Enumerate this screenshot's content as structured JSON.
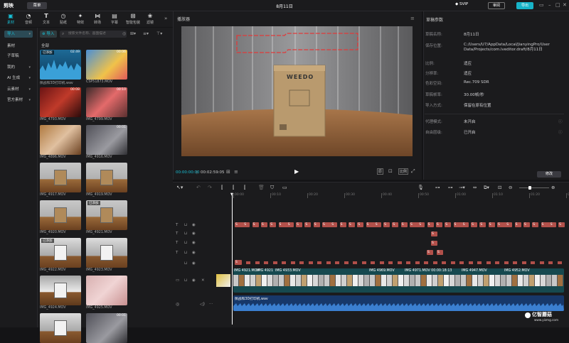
{
  "app": {
    "logo": "剪映",
    "menu": "菜单",
    "title": "8月11日",
    "vip": "SVIP",
    "share": "审阅",
    "export": "导出"
  },
  "toolbar": [
    {
      "label": "素材",
      "icon": "media-icon",
      "active": true
    },
    {
      "label": "音频",
      "icon": "audio-icon"
    },
    {
      "label": "文本",
      "icon": "text-icon"
    },
    {
      "label": "贴纸",
      "icon": "sticker-icon"
    },
    {
      "label": "特效",
      "icon": "effects-icon"
    },
    {
      "label": "转场",
      "icon": "transition-icon"
    },
    {
      "label": "字幕",
      "icon": "captions-icon"
    },
    {
      "label": "智能包装",
      "icon": "smart-pack-icon"
    },
    {
      "label": "滤镜",
      "icon": "filter-icon"
    }
  ],
  "leftnav": [
    {
      "label": "导入",
      "selected": true
    },
    {
      "label": "素材"
    },
    {
      "label": "子草稿"
    },
    {
      "label": "我的"
    },
    {
      "label": "AI 生成"
    },
    {
      "label": "云素材"
    },
    {
      "label": "官方素材"
    }
  ],
  "media": {
    "import": "导入",
    "search_placeholder": "搜索文件名称、画面描述",
    "section": "全部",
    "items": [
      {
        "name": "佩战和3D打印机.wav",
        "dur": "02:49",
        "type": "audio",
        "added": "已添加"
      },
      {
        "name": "CSP51873.MOV",
        "dur": "00:06",
        "type": "art"
      },
      {
        "name": "IMG_4793.MOV",
        "dur": "00:08",
        "type": "red"
      },
      {
        "name": "IMG_4799.MOV",
        "dur": "00:10",
        "type": "phone"
      },
      {
        "name": "IMG_4896.MOV",
        "dur": "",
        "type": "hand"
      },
      {
        "name": "IMG_4916.MOV",
        "dur": "00:01",
        "type": "dark"
      },
      {
        "name": "IMG_4917.MOV",
        "dur": "",
        "type": "box"
      },
      {
        "name": "IMG_4919.MOV",
        "dur": "",
        "type": "box"
      },
      {
        "name": "IMG_4920.MOV",
        "dur": "",
        "type": "box"
      },
      {
        "name": "IMG_4921.MOV",
        "dur": "",
        "type": "box",
        "added": "已添加"
      },
      {
        "name": "IMG_4922.MOV",
        "dur": "",
        "type": "printer",
        "added": "已添加"
      },
      {
        "name": "IMG_4923.MOV",
        "dur": "",
        "type": "printer"
      },
      {
        "name": "IMG_4924.MOV",
        "dur": "",
        "type": "printer2"
      },
      {
        "name": "IMG_4925.MOV",
        "dur": "",
        "type": "pink"
      },
      {
        "name": "",
        "dur": "",
        "type": "printer"
      },
      {
        "name": "",
        "dur": "00:01",
        "type": "dark"
      }
    ]
  },
  "player": {
    "title": "播放器",
    "current": "00:00:00:00",
    "total": "00:02:59:05",
    "box_brand": "WEEDO"
  },
  "props": {
    "title": "草稿参数",
    "rows": [
      {
        "label": "草稿名称:",
        "value": "8月11日"
      },
      {
        "label": "保存位置:",
        "value": "C:/Users/U7/AppData/Local/JianyingPro/User Data/Projects/com.lveditor.draft/8月11日"
      },
      {
        "label": "比例:",
        "value": "适应"
      },
      {
        "label": "分辨率:",
        "value": "适应"
      },
      {
        "label": "色彩空间:",
        "value": "Rec.709 SDR"
      },
      {
        "label": "草稿帧率:",
        "value": "30.00帧/秒"
      },
      {
        "label": "导入方式:",
        "value": "保留在原有位置"
      },
      {
        "label": "代理模式:",
        "value": "未开启"
      },
      {
        "label": "自由层级:",
        "value": "已开启"
      }
    ],
    "modify": "修改"
  },
  "timeline": {
    "ticks": [
      "00:00",
      "00:10",
      "00:20",
      "00:30",
      "00:40",
      "00:50",
      "01:00",
      "01:10",
      "01:20",
      "01:30"
    ],
    "video_clips": [
      "IMG 4921.MOV",
      "IMG 4921",
      "IMG 4933.MOV",
      "IMG 4969.MOV",
      "IMG 4971.MOV 00:00:18:13",
      "IMG 4947.MOV",
      "IMG 4952.MOV"
    ],
    "audio_name": "佩战和3D打印机.wav",
    "sub_label": "S"
  },
  "watermark": {
    "text": "亿智蘑菇",
    "url": "www.yizmg.com"
  }
}
